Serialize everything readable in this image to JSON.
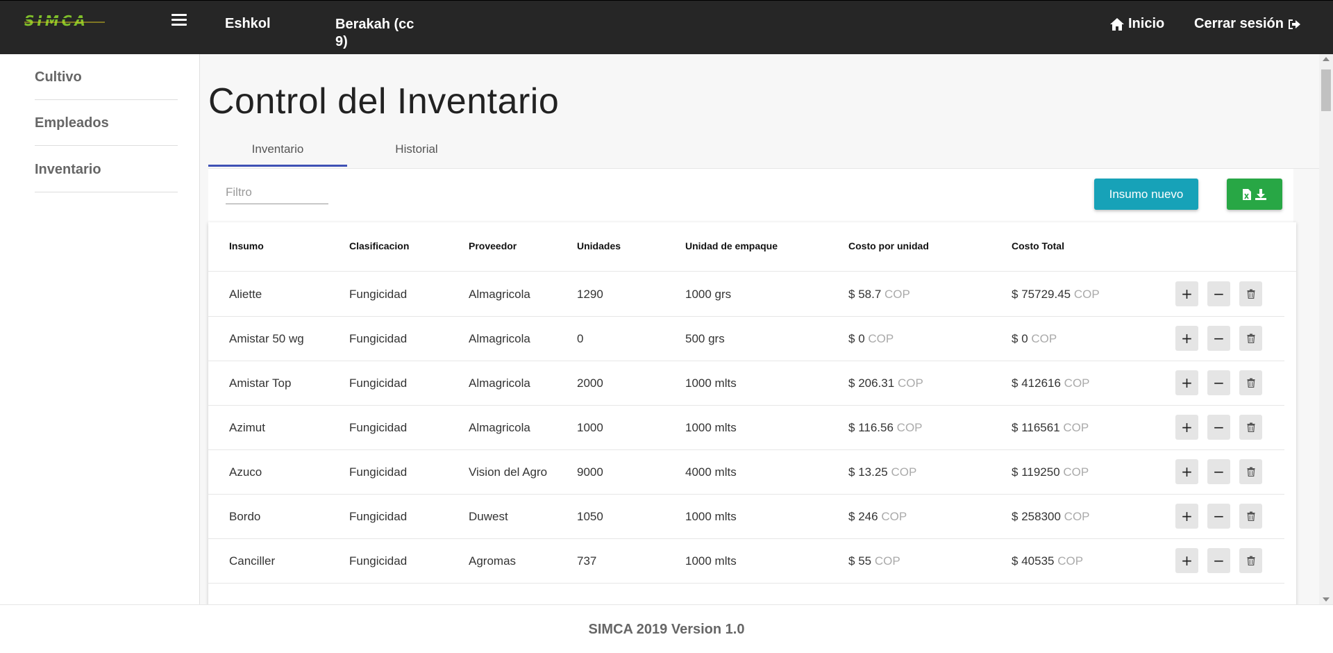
{
  "navbar": {
    "logo_text": "SIMCA",
    "farm": "Eshkol",
    "user": "Berakah (cc 9)",
    "home_label": "Inicio",
    "logout_label": "Cerrar sesión"
  },
  "sidebar": {
    "items": [
      {
        "label": "Cultivo"
      },
      {
        "label": "Empleados"
      },
      {
        "label": "Inventario"
      }
    ]
  },
  "main": {
    "title": "Control del Inventario",
    "tabs": [
      {
        "label": "Inventario",
        "active": true
      },
      {
        "label": "Historial",
        "active": false
      }
    ],
    "filter_placeholder": "Filtro",
    "new_button": "Insumo nuevo",
    "export_icon": "excel-download-icon"
  },
  "table": {
    "headers": [
      "Insumo",
      "Clasificacion",
      "Proveedor",
      "Unidades",
      "Unidad de empaque",
      "Costo por unidad",
      "Costo Total"
    ],
    "currency_symbol": "$",
    "currency_code": "COP",
    "rows": [
      {
        "insumo": "Aliette",
        "clasificacion": "Fungicidad",
        "proveedor": "Almagricola",
        "unidades": "1290",
        "empaque": "1000 grs",
        "costo_unidad": "58.7",
        "costo_total": "75729.45"
      },
      {
        "insumo": "Amistar 50 wg",
        "clasificacion": "Fungicidad",
        "proveedor": "Almagricola",
        "unidades": "0",
        "empaque": "500 grs",
        "costo_unidad": "0",
        "costo_total": "0"
      },
      {
        "insumo": "Amistar Top",
        "clasificacion": "Fungicidad",
        "proveedor": "Almagricola",
        "unidades": "2000",
        "empaque": "1000 mlts",
        "costo_unidad": "206.31",
        "costo_total": "412616"
      },
      {
        "insumo": "Azimut",
        "clasificacion": "Fungicidad",
        "proveedor": "Almagricola",
        "unidades": "1000",
        "empaque": "1000 mlts",
        "costo_unidad": "116.56",
        "costo_total": "116561"
      },
      {
        "insumo": "Azuco",
        "clasificacion": "Fungicidad",
        "proveedor": "Vision del Agro",
        "unidades": "9000",
        "empaque": "4000 mlts",
        "costo_unidad": "13.25",
        "costo_total": "119250"
      },
      {
        "insumo": "Bordo",
        "clasificacion": "Fungicidad",
        "proveedor": "Duwest",
        "unidades": "1050",
        "empaque": "1000 mlts",
        "costo_unidad": "246",
        "costo_total": "258300"
      },
      {
        "insumo": "Canciller",
        "clasificacion": "Fungicidad",
        "proveedor": "Agromas",
        "unidades": "737",
        "empaque": "1000 mlts",
        "costo_unidad": "55",
        "costo_total": "40535"
      }
    ],
    "action_labels": {
      "add": "+",
      "subtract": "−"
    }
  },
  "footer": {
    "text": "SIMCA 2019 Version 1.0"
  },
  "colors": {
    "navbar": "#262626",
    "tab_active": "#3f51b5",
    "btn_new": "#17a2b8",
    "btn_excel": "#28a745",
    "logo_green": "#7fbf2a"
  }
}
